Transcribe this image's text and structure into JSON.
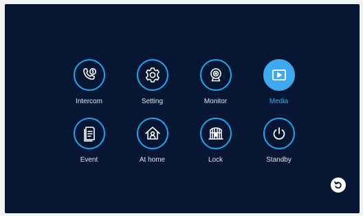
{
  "colors": {
    "screen_background": "#071733",
    "icon_ring": "#22a3ee",
    "active_fill": "#3fa9f0",
    "label_text": "#dfe6ee",
    "active_label": "#39aaf5"
  },
  "menu": {
    "items": [
      {
        "label": "Intercom",
        "icon": "phone-call-icon",
        "active": false
      },
      {
        "label": "Setting",
        "icon": "gear-icon",
        "active": false
      },
      {
        "label": "Monitor",
        "icon": "webcam-icon",
        "active": false
      },
      {
        "label": "Media",
        "icon": "media-play-icon",
        "active": true
      },
      {
        "label": "Event",
        "icon": "document-icon",
        "active": false
      },
      {
        "label": "At home",
        "icon": "home-person-icon",
        "active": false
      },
      {
        "label": "Lock",
        "icon": "gate-lock-icon",
        "active": false
      },
      {
        "label": "Standby",
        "icon": "power-icon",
        "active": false
      }
    ]
  },
  "back_button": {
    "icon": "back-arrow-icon"
  }
}
